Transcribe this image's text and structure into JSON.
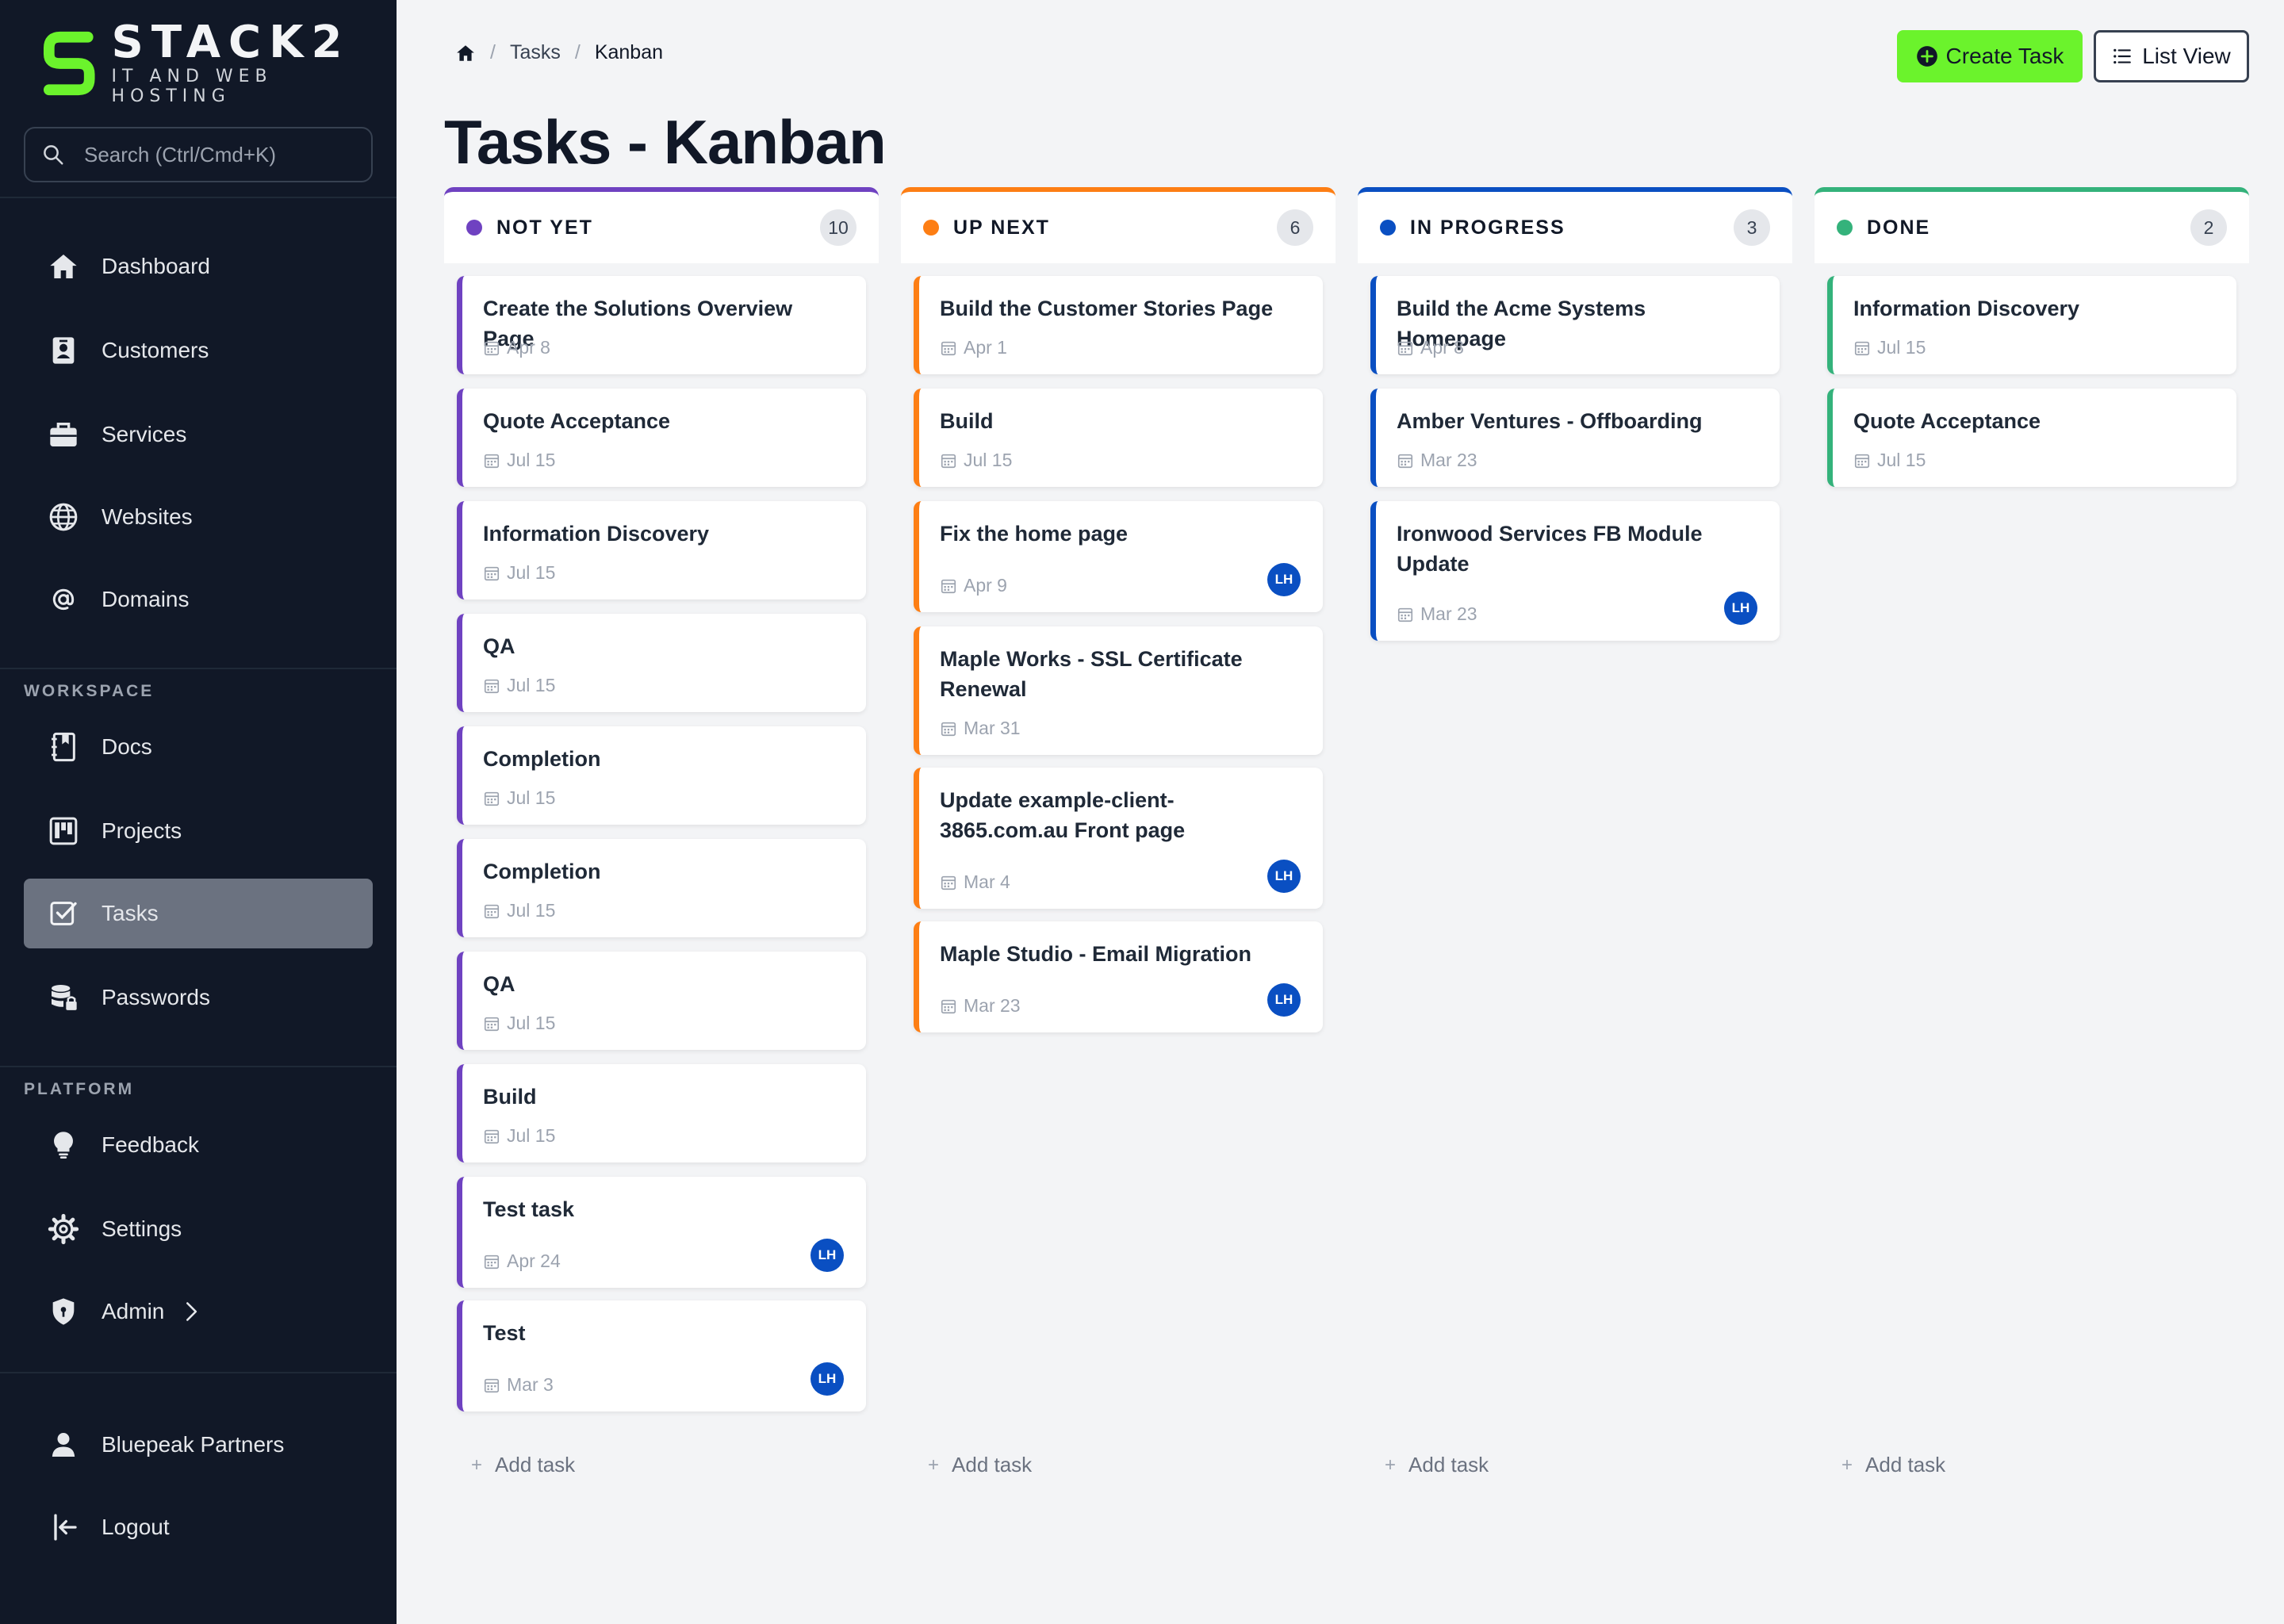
{
  "brand": {
    "name": "STACK2",
    "tagline": "IT AND WEB HOSTING",
    "accent": "#6bf32c"
  },
  "search": {
    "placeholder": "Search (Ctrl/Cmd+K)"
  },
  "nav": {
    "main": [
      {
        "label": "Dashboard",
        "icon": "house-icon"
      },
      {
        "label": "Customers",
        "icon": "id-badge-icon"
      },
      {
        "label": "Services",
        "icon": "briefcase-icon"
      },
      {
        "label": "Websites",
        "icon": "globe-icon"
      },
      {
        "label": "Domains",
        "icon": "at-sign-icon"
      }
    ],
    "workspace_label": "WORKSPACE",
    "workspace": [
      {
        "label": "Docs",
        "icon": "notebook-icon"
      },
      {
        "label": "Projects",
        "icon": "kanban-board-icon"
      },
      {
        "label": "Tasks",
        "icon": "checkbox-icon",
        "active": true
      },
      {
        "label": "Passwords",
        "icon": "database-lock-icon"
      }
    ],
    "platform_label": "PLATFORM",
    "platform": [
      {
        "label": "Feedback",
        "icon": "lightbulb-icon"
      },
      {
        "label": "Settings",
        "icon": "gear-icon"
      },
      {
        "label": "Admin",
        "icon": "shield-icon"
      }
    ],
    "account": {
      "label": "Bluepeak Partners",
      "icon": "user-icon"
    },
    "logout": {
      "label": "Logout",
      "icon": "logout-icon"
    }
  },
  "breadcrumb": {
    "home_icon": "home-icon",
    "tasks": "Tasks",
    "current": "Kanban"
  },
  "actions": {
    "create_task": "Create Task",
    "list_view": "List View"
  },
  "page": {
    "title": "Tasks - Kanban"
  },
  "add_task_label": "Add task",
  "columns": [
    {
      "title": "NOT YET",
      "count": "10",
      "color": "#6f42c1",
      "cards": [
        {
          "title": "Create the Solutions Overview Page",
          "date": "Apr 8"
        },
        {
          "title": "Quote Acceptance",
          "date": "Jul 15"
        },
        {
          "title": "Information Discovery",
          "date": "Jul 15"
        },
        {
          "title": "QA",
          "date": "Jul 15"
        },
        {
          "title": "Completion",
          "date": "Jul 15"
        },
        {
          "title": "Completion",
          "date": "Jul 15"
        },
        {
          "title": "QA",
          "date": "Jul 15"
        },
        {
          "title": "Build",
          "date": "Jul 15"
        },
        {
          "title": "Test task",
          "date": "Apr 24",
          "assignee": "LH"
        },
        {
          "title": "Test",
          "date": "Mar 3",
          "assignee": "LH"
        }
      ]
    },
    {
      "title": "UP NEXT",
      "count": "6",
      "color": "#fd7e14",
      "cards": [
        {
          "title": "Build the Customer Stories Page",
          "date": "Apr 1"
        },
        {
          "title": "Build",
          "date": "Jul 15"
        },
        {
          "title": "Fix the home page",
          "date": "Apr 9",
          "assignee": "LH"
        },
        {
          "title": "Maple Works - SSL Certificate Renewal",
          "date": "Mar 31"
        },
        {
          "title": "Update example-client-3865.com.au Front page",
          "date": "Mar 4",
          "assignee": "LH"
        },
        {
          "title": "Maple Studio - Email Migration",
          "date": "Mar 23",
          "assignee": "LH"
        }
      ]
    },
    {
      "title": "IN PROGRESS",
      "count": "3",
      "color": "#0a4fc2",
      "cards": [
        {
          "title": "Build the Acme Systems Homepage",
          "date": "Apr 8"
        },
        {
          "title": "Amber Ventures - Offboarding",
          "date": "Mar 23"
        },
        {
          "title": "Ironwood Services FB Module Update",
          "date": "Mar 23",
          "assignee": "LH"
        }
      ]
    },
    {
      "title": "DONE",
      "count": "2",
      "color": "#34b27b",
      "cards": [
        {
          "title": "Information Discovery",
          "date": "Jul 15"
        },
        {
          "title": "Quote Acceptance",
          "date": "Jul 15"
        }
      ]
    }
  ]
}
